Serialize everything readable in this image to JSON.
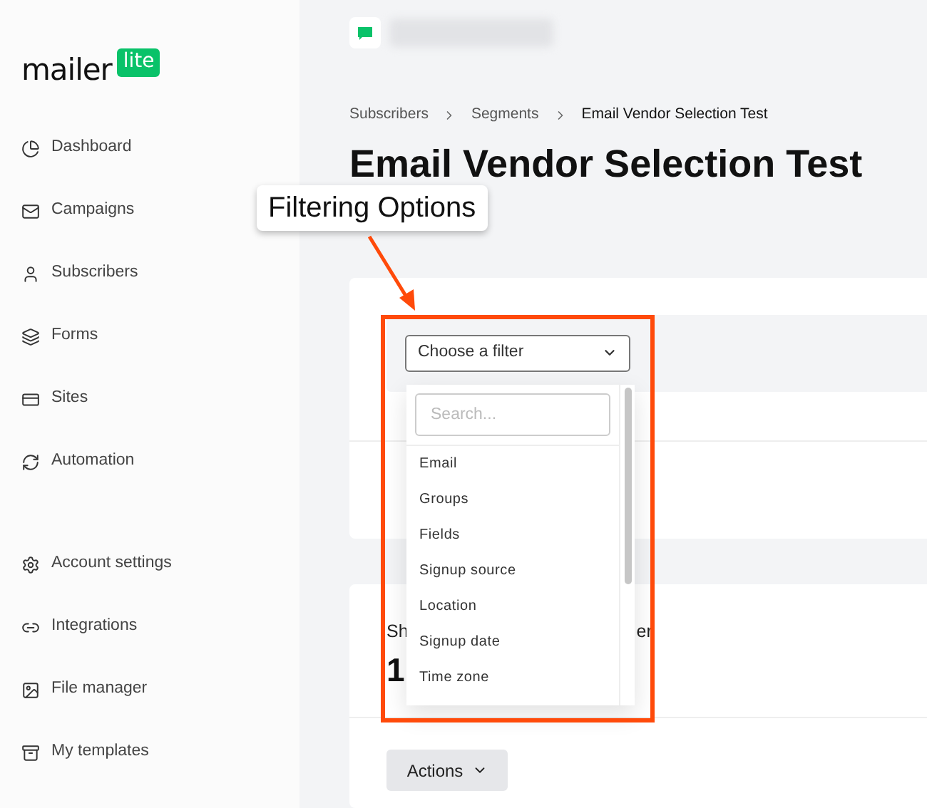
{
  "logo": {
    "word": "mailer",
    "badge": "lite"
  },
  "sidebar": {
    "main_items": [
      "Dashboard",
      "Campaigns",
      "Subscribers",
      "Forms",
      "Sites",
      "Automation"
    ],
    "account_items": [
      "Account settings",
      "Integrations",
      "File manager",
      "My templates"
    ]
  },
  "breadcrumb": [
    "Subscribers",
    "Segments",
    "Email Vendor Selection Test"
  ],
  "page_title": "Email Vendor Selection Test",
  "filter": {
    "select": "Choose a filter",
    "search_placeholder": "Search...",
    "options": [
      "Email",
      "Groups",
      "Fields",
      "Signup source",
      "Location",
      "Signup date",
      "Time zone"
    ]
  },
  "stats": {
    "label_start": "Sh",
    "label_end": "er",
    "value": "1"
  },
  "actions_button": "Actions",
  "annotation": {
    "callout": "Filtering Options"
  }
}
